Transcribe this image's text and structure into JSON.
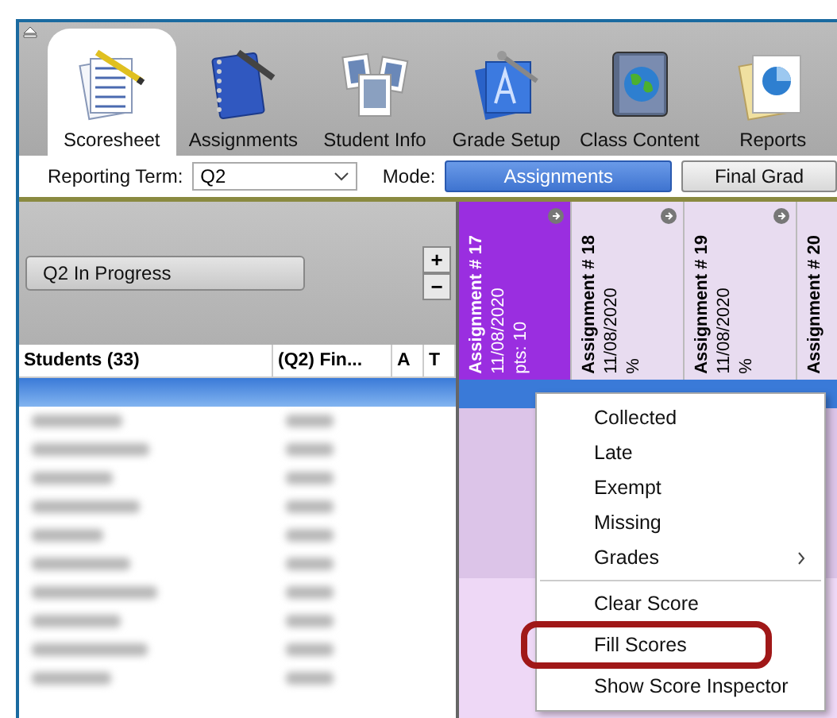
{
  "toolbar": {
    "tabs": [
      {
        "label": "Scoresheet",
        "selected": true
      },
      {
        "label": "Assignments",
        "selected": false
      },
      {
        "label": "Student Info",
        "selected": false
      },
      {
        "label": "Grade Setup",
        "selected": false
      },
      {
        "label": "Class Content",
        "selected": false
      },
      {
        "label": "Reports",
        "selected": false
      }
    ]
  },
  "filter_bar": {
    "reporting_term_label": "Reporting Term:",
    "reporting_term_value": "Q2",
    "mode_label": "Mode:",
    "mode_buttons": [
      {
        "label": "Assignments",
        "selected": true
      },
      {
        "label": "Final Grad",
        "selected": false
      }
    ]
  },
  "status_button": "Q2 In Progress",
  "zoom_buttons": [
    "+",
    "−"
  ],
  "columns": [
    "Students (33)",
    "(Q2) Fin...",
    "A",
    "T"
  ],
  "assignments": [
    {
      "title": "Assignment # 17",
      "date": "11/08/2020",
      "detail": "pts: 10",
      "selected": true
    },
    {
      "title": "Assignment # 18",
      "date": "11/08/2020",
      "detail": "%",
      "selected": false
    },
    {
      "title": "Assignment # 19",
      "date": "11/08/2020",
      "detail": "%",
      "selected": false
    },
    {
      "title": "Assignment # 20",
      "selected": false
    }
  ],
  "context_menu": {
    "items": [
      {
        "label": "Collected",
        "kind": "item",
        "annotated": false
      },
      {
        "label": "Late",
        "kind": "item",
        "annotated": false
      },
      {
        "label": "Exempt",
        "kind": "item",
        "annotated": false
      },
      {
        "label": "Missing",
        "kind": "item",
        "annotated": false
      },
      {
        "label": "Grades",
        "kind": "submenu",
        "annotated": false
      },
      {
        "kind": "separator"
      },
      {
        "label": "Clear Score",
        "kind": "item",
        "annotated": false
      },
      {
        "label": "Fill Scores",
        "kind": "item",
        "annotated": true
      },
      {
        "label": "Show Score Inspector",
        "kind": "item",
        "annotated": false
      }
    ]
  }
}
